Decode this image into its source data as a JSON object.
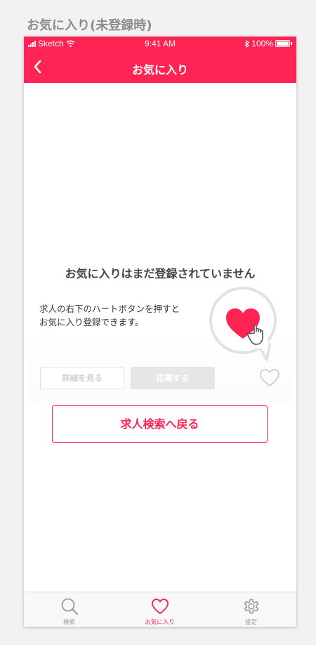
{
  "artboard_title": "お気に入り(未登録時)",
  "status_bar": {
    "carrier": "Sketch",
    "time": "9:41 AM",
    "battery": "100%",
    "icons": [
      "signal-bars-icon",
      "wifi-icon",
      "bluetooth-icon",
      "battery-icon"
    ]
  },
  "nav": {
    "title": "お気に入り",
    "back_icon": "chevron-left-icon"
  },
  "empty_state": {
    "title": "お気に入りはまだ登録されていません",
    "description_lines": [
      "求人の右下のハートボタンを押すと",
      "お気に入り登録できます。"
    ],
    "sample_card": {
      "detail_button": "詳細を見る",
      "apply_button": "応募する",
      "heart_icon": "heart-outline-icon",
      "bubble_icon": "heart-filled-hand-pointer-icon"
    },
    "back_button": "求人検索へ戻る"
  },
  "tabs": [
    {
      "label": "検索",
      "icon": "search-icon",
      "active": false
    },
    {
      "label": "お気に入り",
      "icon": "heart-icon",
      "active": true
    },
    {
      "label": "設定",
      "icon": "gear-icon",
      "active": false
    }
  ],
  "colors": {
    "accent": "#ff2454",
    "tab_inactive": "#999999",
    "disabled": "#e6e6e6"
  }
}
